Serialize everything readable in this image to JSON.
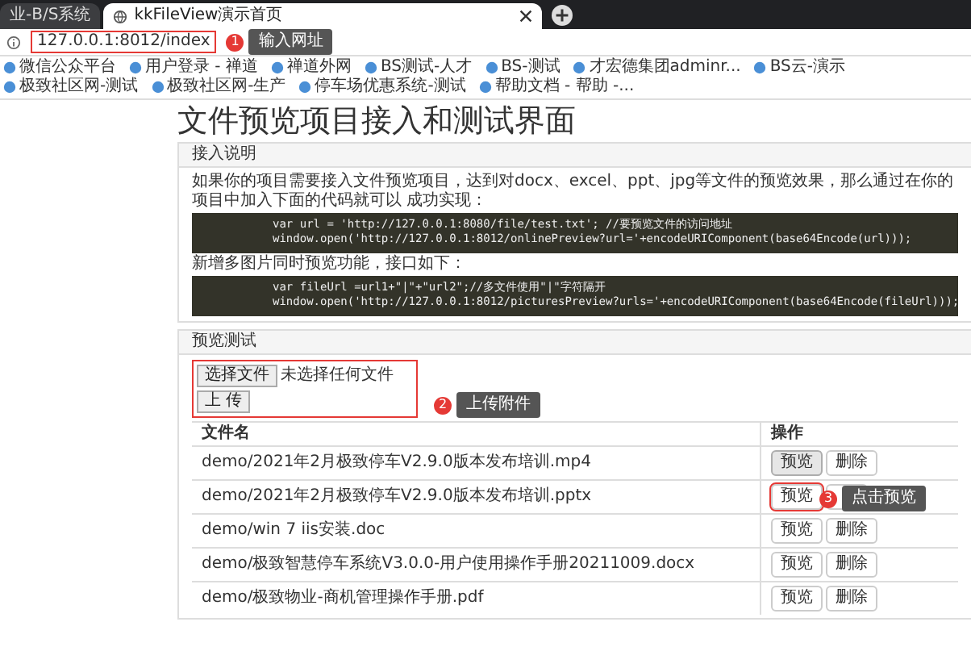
{
  "browser": {
    "tabs": [
      {
        "title": "业-B/S系统",
        "selected": false
      },
      {
        "title": "kkFileView演示首页",
        "selected": true
      }
    ],
    "address": "127.0.0.1:8012/index",
    "address_annotation": {
      "number": "1",
      "label": "输入网址"
    },
    "bookmarks": [
      "微信公众平台",
      "用户登录 - 禅道",
      "禅道外网",
      "BS测试-人才",
      "BS-测试",
      "才宏德集团adminr...",
      "BS云-演示",
      "极致社区网-测试",
      "极致社区网-生产",
      "停车场优惠系统-测试",
      "帮助文档 - 帮助 -..."
    ]
  },
  "page": {
    "title": "文件预览项目接入和测试界面",
    "intro_panel": {
      "heading": "接入说明",
      "blocks": [
        {
          "kind": "text",
          "text": "如果你的项目需要接入文件预览项目，达到对docx、excel、ppt、jpg等文件的预览效果，那么通过在你的项目中加入下面的代码就可以 成功实现："
        },
        {
          "kind": "code",
          "lines": [
            "var url = 'http://127.0.0.1:8080/file/test.txt'; //要预览文件的访问地址",
            "window.open('http://127.0.0.1:8012/onlinePreview?url='+encodeURIComponent(base64Encode(url)));"
          ]
        },
        {
          "kind": "text",
          "text": "新增多图片同时预览功能，接口如下："
        },
        {
          "kind": "code",
          "lines": [
            "var fileUrl =url1+\"|\"+\"url2\";//多文件使用\"|\"字符隔开",
            "window.open('http://127.0.0.1:8012/picturesPreview?urls='+encodeURIComponent(base64Encode(fileUrl)));"
          ]
        }
      ]
    },
    "test_panel": {
      "heading": "预览测试",
      "choose_button": "选择文件",
      "no_file": "未选择任何文件",
      "upload_button": "上 传",
      "upload_annotation": {
        "number": "2",
        "label": "上传附件"
      },
      "columns": [
        "文件名",
        "操作"
      ],
      "rows": [
        {
          "name": "demo/2021年2月极致停车V2.9.0版本发布培训.mp4",
          "preview": "预览",
          "delete": "删除",
          "active": true
        },
        {
          "name": "demo/2021年2月极致停车V2.9.0版本发布培训.pptx",
          "preview": "预览",
          "active": false,
          "annotation": {
            "number": "3",
            "label": "点击预览"
          }
        },
        {
          "name": "demo/win 7 iis安装.doc",
          "preview": "预览",
          "delete": "删除",
          "active": false
        },
        {
          "name": "demo/极致智慧停车系统V3.0.0-用户使用操作手册20211009.docx",
          "preview": "预览",
          "delete": "删除",
          "active": false
        },
        {
          "name": "demo/极致物业-商机管理操作手册.pdf",
          "preview": "预览",
          "delete": "删除",
          "active": false
        }
      ]
    }
  }
}
